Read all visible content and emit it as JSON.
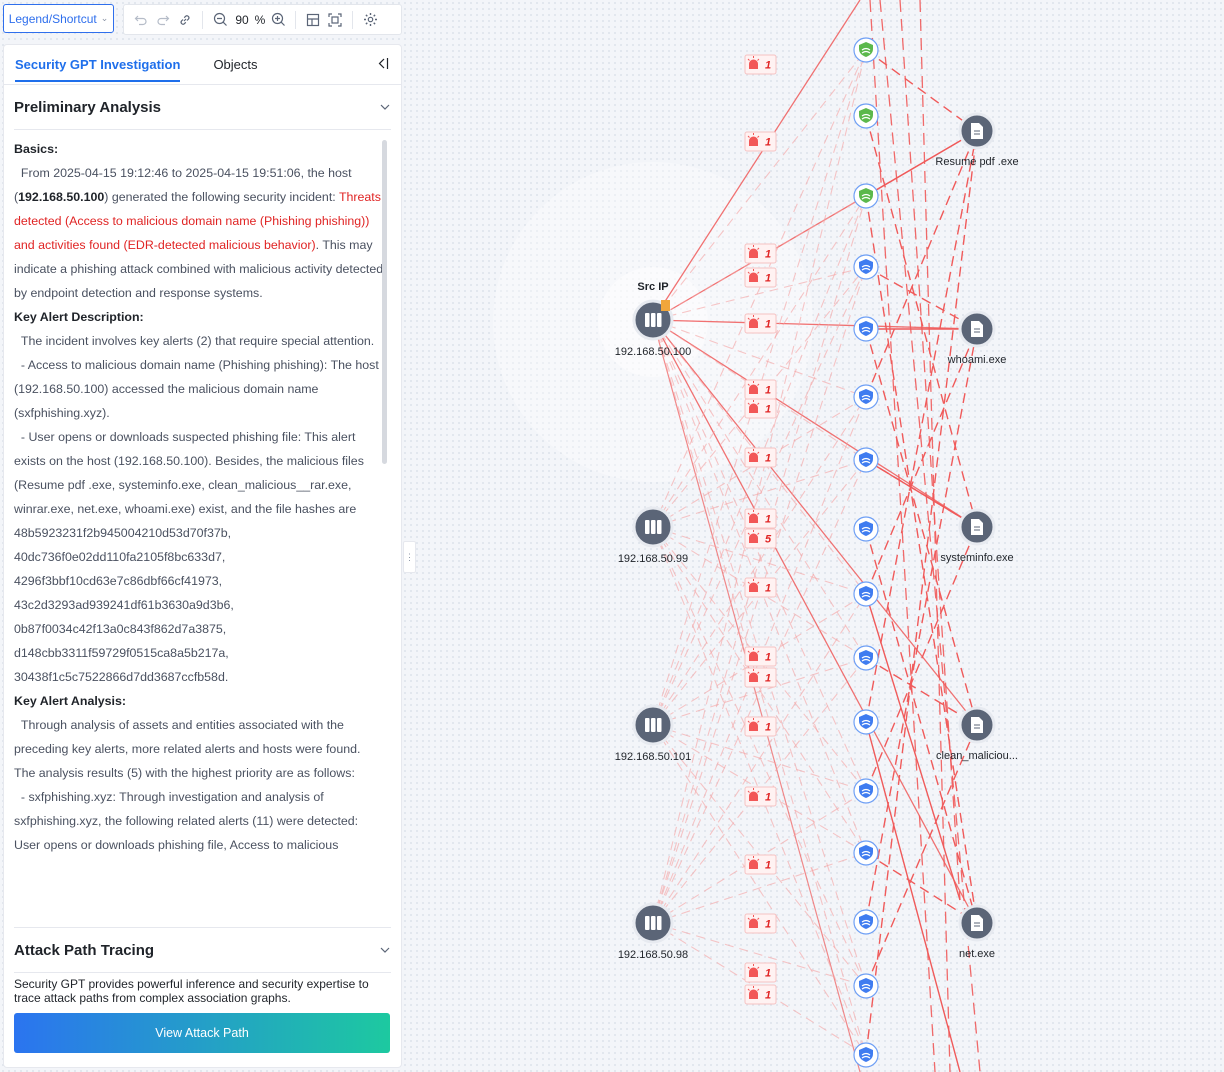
{
  "toolbar": {
    "legend_label": "Legend/Shortcut",
    "zoom_value": "90",
    "zoom_unit": "%"
  },
  "panel": {
    "tabs": [
      "Security GPT Investigation",
      "Objects"
    ],
    "prelim_title": "Preliminary Analysis",
    "basics_heading": "Basics:",
    "basics_p1": "From 2025-04-15 19:12:46 to 2025-04-15 19:51:06, the host (",
    "basics_host": "192.168.50.100",
    "basics_p2": ") generated the following security incident: ",
    "basics_red": "Threats detected (Access to malicious domain name (Phishing phishing)) and activities found (EDR-detected malicious behavior)",
    "basics_p3": ". This may indicate a phishing attack combined with malicious activity detected by endpoint detection and response systems.",
    "kad_heading": "Key Alert Description:",
    "kad_p1": "The incident involves key alerts (2) that require special attention.",
    "kad_p2": "- Access to malicious domain name (Phishing phishing): The host (192.168.50.100) accessed the malicious domain name (sxfphishing.xyz).",
    "kad_p3": "- User opens or downloads suspected phishing file: This alert exists on the host (192.168.50.100). Besides, the malicious files (Resume pdf .exe, systeminfo.exe, clean_malicious__rar.exe, winrar.exe, net.exe, whoami.exe) exist, and the file hashes are 48b5923231f2b945004210d53d70f37b, 40dc736f0e02dd110fa2105f8bc633d7, 4296f3bbf10cd63e7c86dbf66cf41973, 43c2d3293ad939241df61b3630a9d3b6, 0b87f0034c42f13a0c843f862d7a3875, d148cbb3311f59729f0515ca8a5b217a, 30438f1c5c7522866d7dd3687ccfb58d.",
    "kaa_heading": "Key Alert Analysis:",
    "kaa_p1": "Through analysis of assets and entities associated with the preceding key alerts, more related alerts and hosts were found. The analysis results (5) with the highest priority are as follows:",
    "kaa_p2": "- sxfphishing.xyz: Through investigation and analysis of sxfphishing.xyz, the following related alerts (11) were detected:",
    "kaa_p3": "User opens or downloads phishing file, Access to malicious",
    "attack_title": "Attack Path Tracing",
    "attack_desc": "Security GPT provides powerful inference and security expertise to trace attack paths from complex association graphs.",
    "attack_button": "View Attack Path"
  },
  "graph": {
    "src_label": "Src IP",
    "hosts": [
      "192.168.50.100",
      "192.168.50.99",
      "192.168.50.101",
      "192.168.50.98"
    ],
    "files": [
      "Resume pdf .exe",
      "whoami.exe",
      "systeminfo.exe",
      "clean_maliciou...",
      "net.exe"
    ],
    "alert_counts": [
      "1",
      "1",
      "1",
      "1",
      "1",
      "1",
      "1",
      "1",
      "1",
      "5",
      "1",
      "1",
      "1",
      "1",
      "1",
      "1",
      "1",
      "1",
      "1"
    ],
    "colors": {
      "accent": "#1f6feb",
      "alert": "#e02424",
      "edge": "#f05a5a",
      "node": "#5b6577"
    }
  }
}
